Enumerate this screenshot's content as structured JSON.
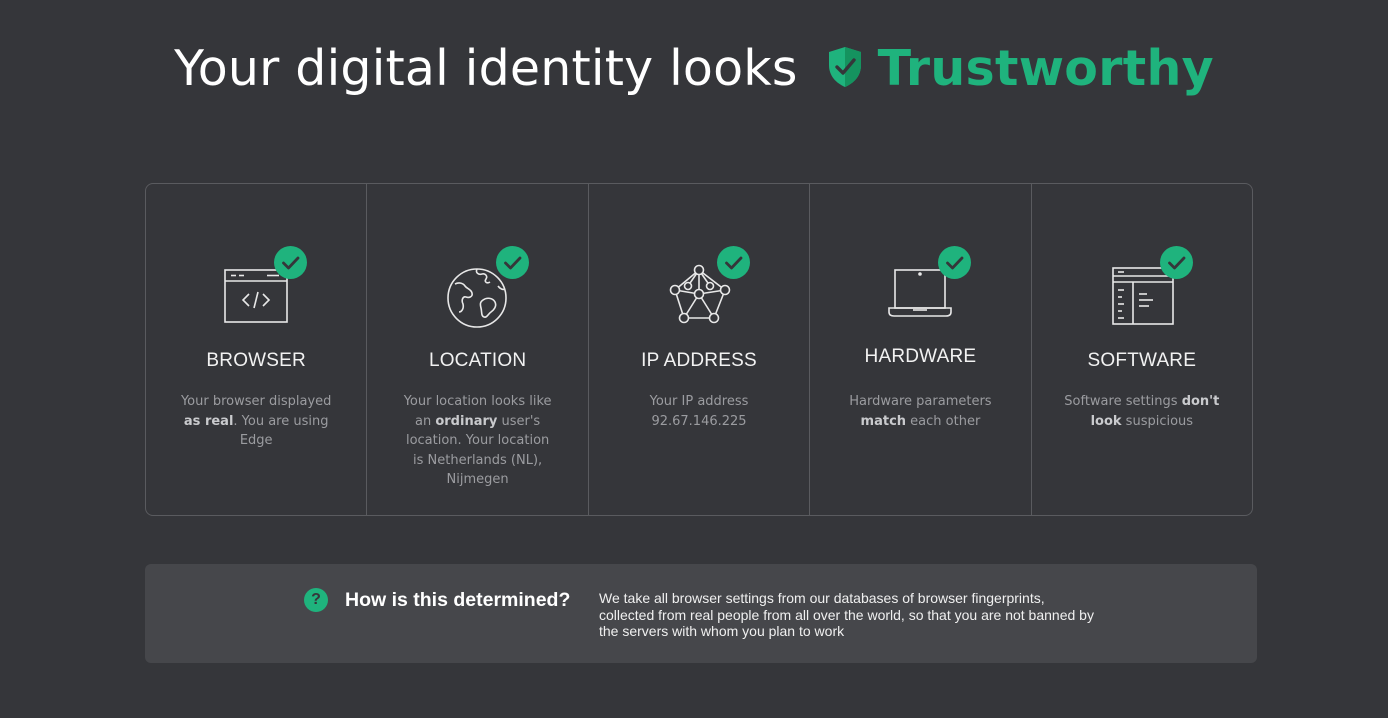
{
  "header": {
    "prefix": "Your digital identity looks",
    "verdict": "Trustworthy",
    "shield_icon": "shield-check-icon",
    "accent_color": "#1fb37d"
  },
  "checks": [
    {
      "title": "BROWSER",
      "icon": "browser-code-icon",
      "status_icon": "check-circle-icon",
      "desc": {
        "before": "Your browser displayed ",
        "bold": "as real",
        "after": ". You are using Edge"
      }
    },
    {
      "title": "LOCATION",
      "icon": "globe-icon",
      "status_icon": "check-circle-icon",
      "desc": {
        "before": "Your location looks like an ",
        "bold": "ordinary",
        "after": " user's location. Your location is Netherlands (NL), Nijmegen"
      }
    },
    {
      "title": "IP ADDRESS",
      "icon": "network-icon",
      "status_icon": "check-circle-icon",
      "desc": {
        "before": "Your IP address 92.67.146.225",
        "bold": "",
        "after": ""
      }
    },
    {
      "title": "HARDWARE",
      "icon": "laptop-icon",
      "status_icon": "check-circle-icon",
      "desc": {
        "before": "Hardware parameters ",
        "bold": "match",
        "after": " each other"
      }
    },
    {
      "title": "SOFTWARE",
      "icon": "software-window-icon",
      "status_icon": "check-circle-icon",
      "desc": {
        "before": "Software settings ",
        "bold": "don't look",
        "after": " suspicious"
      }
    }
  ],
  "info": {
    "icon": "question-circle-icon",
    "icon_glyph": "?",
    "title": "How is this determined?",
    "text": "We take all browser settings from our databases of browser fingerprints, collected from real people from all over the world, so that you are not banned by the servers with whom you plan to work"
  }
}
